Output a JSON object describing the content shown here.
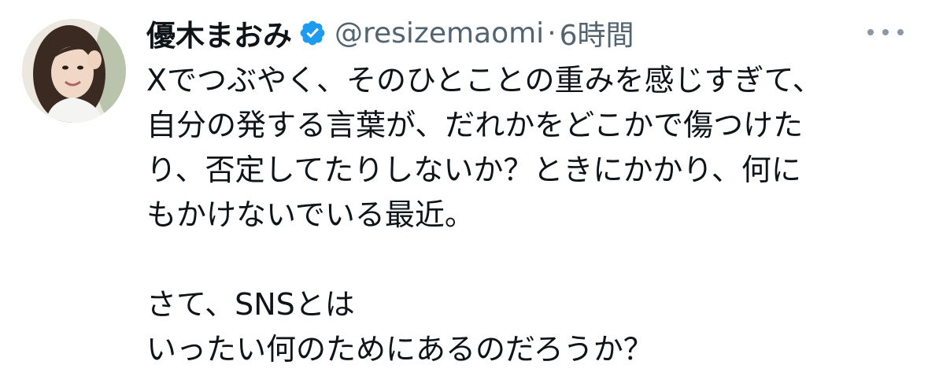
{
  "author": {
    "display_name": "優木まおみ",
    "handle": "@resizemaomi",
    "separator": "·",
    "timestamp": "6時間",
    "verified": true
  },
  "tweet": {
    "lines": [
      "Xでつぶやく、そのひとことの重みを感じすぎて、",
      "自分の発する言葉が、だれかをどこかで傷つけた",
      "り、否定してたりしないか？ときにかかり、何に",
      "もかけないでいる最近。",
      "",
      "さて、SNSとは",
      "いったい何のためにあるのだろうか？"
    ]
  },
  "icons": {
    "verified": "verified-badge-icon",
    "more": "more-options-icon"
  },
  "colors": {
    "text_primary": "#0f1419",
    "text_secondary": "#536471",
    "verified_blue": "#1d9bf0",
    "more_dots": "#8b98a5"
  }
}
